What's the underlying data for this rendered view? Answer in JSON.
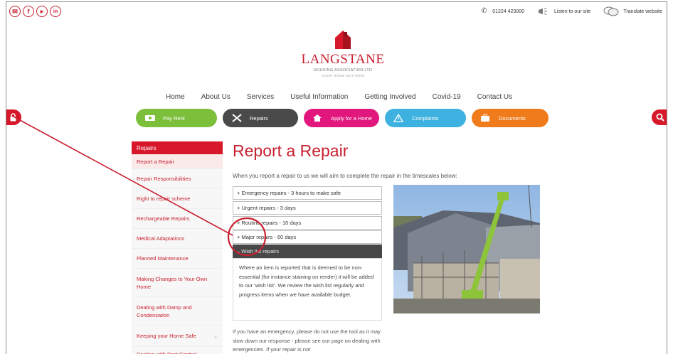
{
  "colors": {
    "brand_red": "#c81f2f",
    "pill_green": "#7cbf3a",
    "pill_dark": "#4a4a4a",
    "pill_magenta": "#e2177d",
    "pill_blue": "#3db1e0",
    "pill_orange": "#ef7b1a",
    "annotation_red": "#c81f2f"
  },
  "top_bar": {
    "social_icons": [
      "email-icon",
      "facebook-icon",
      "youtube-icon",
      "linkedin-icon"
    ],
    "social_glyphs": [
      "✉",
      "f",
      "▶",
      "in"
    ],
    "phone": "01224 423000",
    "listen_label": "Listen to our site",
    "translate_label": "Translate website"
  },
  "logo": {
    "name": "LANGSTANE",
    "subtitle": "HOUSING ASSOCIATION LTD",
    "tagline": "YOUR HOME MATTERS"
  },
  "nav": {
    "items": [
      "Home",
      "About Us",
      "Services",
      "Useful Information",
      "Getting Involved",
      "Covid-19",
      "Contact Us"
    ]
  },
  "pills": [
    {
      "label": "Pay Rent",
      "icon": "cash-icon"
    },
    {
      "label": "Repairs",
      "icon": "tools-icon"
    },
    {
      "label": "Apply for a Home",
      "icon": "home-icon"
    },
    {
      "label": "Complaints",
      "icon": "warning-icon"
    },
    {
      "label": "Documents",
      "icon": "briefcase-icon"
    }
  ],
  "sidebar": {
    "heading": "Repairs",
    "items": [
      "Report a Repair",
      "Repair Responsibilities",
      "Right to repair scheme",
      "Rechargeable Repairs",
      "Medical Adaptations",
      "Planned Maintenance",
      "Making Changes to Your Own Home",
      "Dealing with Damp and Condensation",
      "Keeping your Home Safe",
      "Dealing with Pest Control"
    ]
  },
  "content": {
    "title": "Report a Repair",
    "intro": "When you report a repair to us we will aim to complete the repair in the timescales below:",
    "accordion": [
      {
        "label": "+ Emergency repairs - 3 hours to make safe",
        "open": false
      },
      {
        "label": "+ Urgent repairs - 3 days",
        "open": false
      },
      {
        "label": "+ Routine repairs - 10 days",
        "open": false
      },
      {
        "label": "+ Major repairs - 60 days",
        "open": false
      },
      {
        "label": "– Wish list repairs",
        "open": true
      }
    ],
    "wish_list_body": "Where an item is reported that is deemed to be non-essential (for instance staining on render) it will be added to our 'wish list'. We review the wish list regularly and progress items when we have available budget.",
    "after_text": "If you have an emergency, please do not use the tool as it may slow down our response - please see our page on dealing with emergencies. If your repair is not"
  }
}
